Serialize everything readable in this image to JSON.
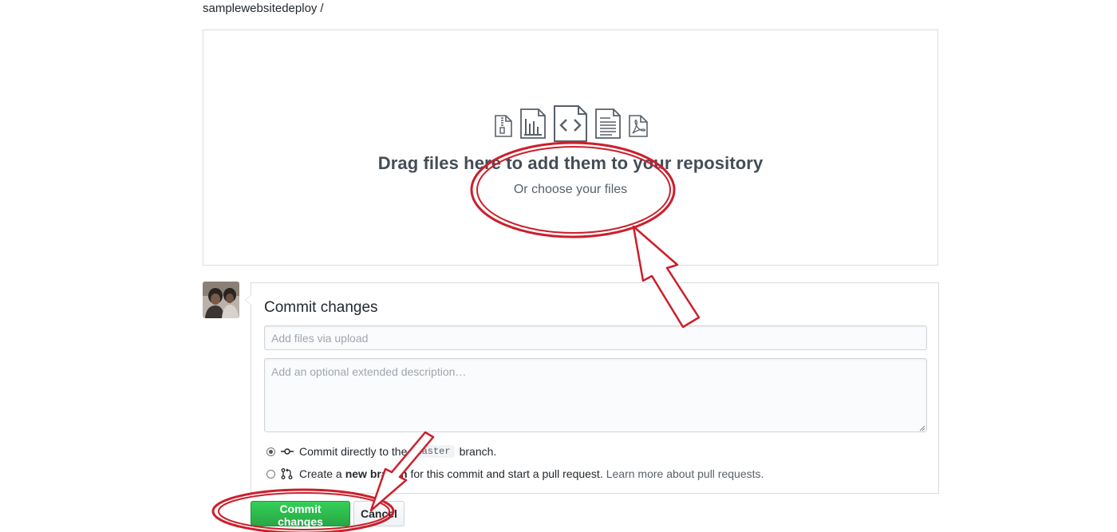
{
  "breadcrumb": {
    "repo": "samplewebsitedeploy",
    "separator": "/"
  },
  "upload": {
    "icons": [
      "zip-file-icon",
      "chart-file-icon",
      "code-file-icon",
      "text-file-icon",
      "pdf-file-icon"
    ],
    "title": "Drag files here to add them to your repository",
    "choose": "Or choose your files"
  },
  "commit": {
    "heading": "Commit changes",
    "summary_placeholder": "Add files via upload",
    "description_placeholder": "Add an optional extended description…",
    "option_direct": {
      "prefix": "Commit directly to the",
      "branch": "master",
      "suffix": "branch.",
      "checked": true
    },
    "option_new": {
      "prefix": "Create a",
      "strong": "new branch",
      "suffix": "for this commit and start a pull request.",
      "link": "Learn more about pull requests.",
      "checked": false
    },
    "submit_label": "Commit changes",
    "cancel_label": "Cancel"
  },
  "colors": {
    "annotation_red": "#cc1f2b",
    "primary_green": "#2cbe4e"
  }
}
